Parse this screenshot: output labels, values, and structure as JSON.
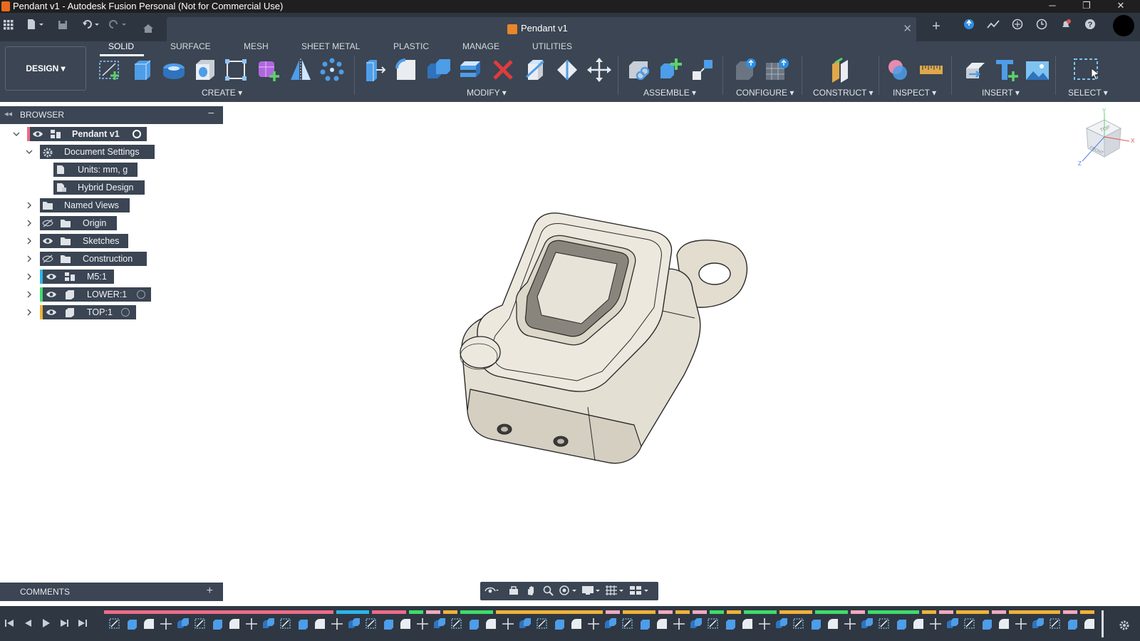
{
  "window": {
    "title": "Pendant v1 - Autodesk Fusion Personal (Not for Commercial Use)",
    "minimize": "─",
    "restore": "❐",
    "close": "✕"
  },
  "document_tab": {
    "label": "Pendant v1",
    "close": "✕"
  },
  "workspace_button": "DESIGN ▾",
  "ribbon_tabs": [
    "SOLID",
    "SURFACE",
    "MESH",
    "SHEET METAL",
    "PLASTIC",
    "MANAGE",
    "UTILITIES"
  ],
  "groups": {
    "create": "CREATE ▾",
    "modify": "MODIFY ▾",
    "assemble": "ASSEMBLE ▾",
    "configure": "CONFIGURE ▾",
    "construct": "CONSTRUCT ▾",
    "inspect": "INSPECT ▾",
    "insert": "INSERT ▾",
    "select": "SELECT ▾"
  },
  "browser": {
    "title": "BROWSER",
    "collapse": "◂◂",
    "minimize": "−",
    "items": {
      "root": "Pendant v1",
      "doc_settings": "Document Settings",
      "units": "Units: mm, g",
      "hybrid": "Hybrid Design",
      "named_views": "Named Views",
      "origin": "Origin",
      "sketches": "Sketches",
      "construction": "Construction",
      "m5": "M5:1",
      "lower": "LOWER:1",
      "top": "TOP:1"
    }
  },
  "comments": {
    "title": "COMMENTS",
    "add": "+"
  },
  "viewcube": {
    "top": "TOP",
    "front": "FRONT",
    "axis_x": "X",
    "axis_y": "Y",
    "axis_z": "Z"
  },
  "colors": {
    "accent_orange": "#e8862a",
    "title_bar": "#1f1f1f",
    "toolbar": "#3b4553",
    "viewport": "#ffffff",
    "model_fill": "#e6e1d6",
    "m5_bar": "#2bb5e8",
    "lower_bar": "#3ddc6a",
    "top_bar": "#f0b23a",
    "root_bar": "#ec6b88"
  }
}
